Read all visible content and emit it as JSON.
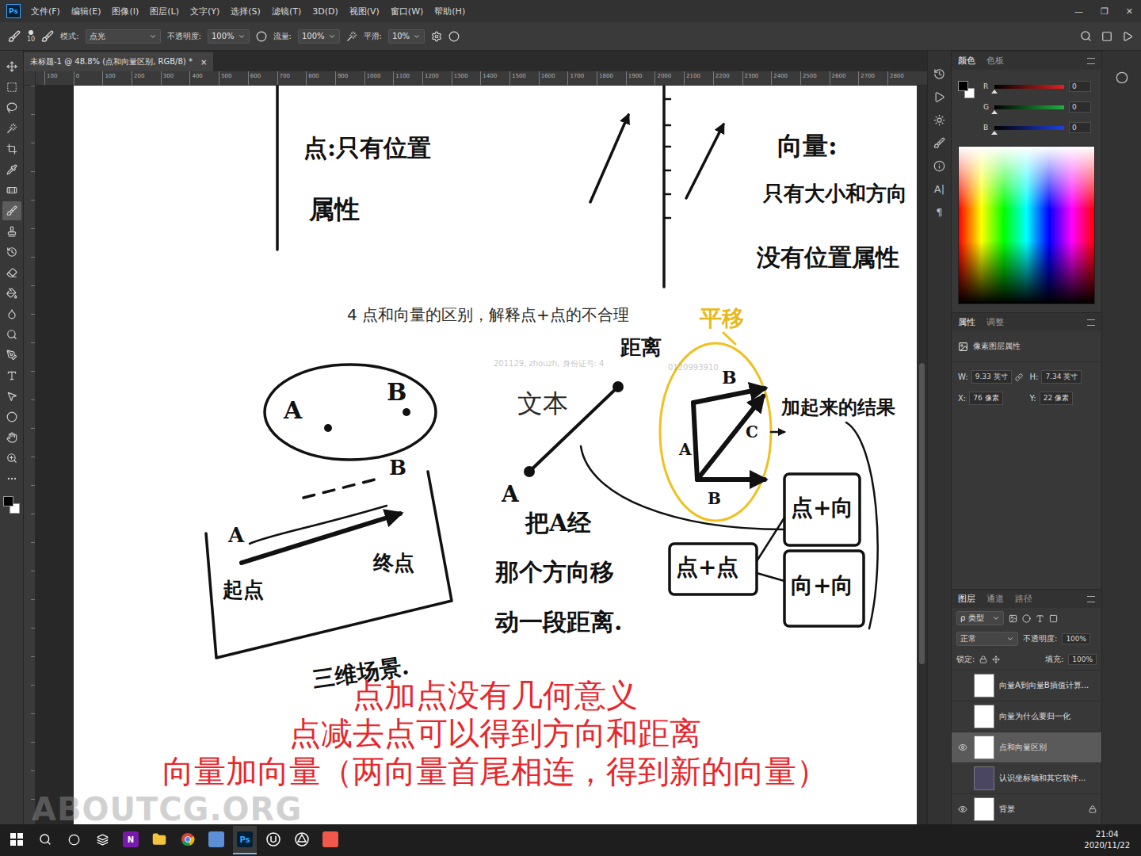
{
  "app": {
    "logo": "Ps",
    "menu": [
      "文件(F)",
      "编辑(E)",
      "图像(I)",
      "图层(L)",
      "文字(Y)",
      "选择(S)",
      "滤镜(T)",
      "3D(D)",
      "视图(V)",
      "窗口(W)",
      "帮助(H)"
    ],
    "window_controls": [
      "—",
      "❐",
      "✕"
    ]
  },
  "options_bar": {
    "brush_size": "10",
    "mode_label": "模式:",
    "mode": "点光",
    "opacity_label": "不透明度:",
    "opacity": "100%",
    "flow_label": "流量:",
    "flow": "100%",
    "smoothing_label": "平滑:",
    "smoothing": "10%"
  },
  "tools": [
    {
      "kind": "move",
      "selected": false
    },
    {
      "kind": "marquee",
      "selected": false
    },
    {
      "kind": "lasso",
      "selected": false
    },
    {
      "kind": "wand",
      "selected": false
    },
    {
      "kind": "crop",
      "selected": false
    },
    {
      "kind": "eyedropper",
      "selected": false
    },
    {
      "kind": "healing",
      "selected": false
    },
    {
      "kind": "brush",
      "selected": true
    },
    {
      "kind": "stamp",
      "selected": false
    },
    {
      "kind": "history",
      "selected": false
    },
    {
      "kind": "eraser",
      "selected": false
    },
    {
      "kind": "bucket",
      "selected": false
    },
    {
      "kind": "blur",
      "selected": false
    },
    {
      "kind": "dodge",
      "selected": false
    },
    {
      "kind": "pen",
      "selected": false
    },
    {
      "kind": "type",
      "selected": false
    },
    {
      "kind": "select",
      "selected": false
    },
    {
      "kind": "shape",
      "selected": false
    },
    {
      "kind": "hand",
      "selected": false
    },
    {
      "kind": "zoom",
      "selected": false
    },
    {
      "kind": "more",
      "selected": false
    }
  ],
  "document": {
    "tab": "未标题-1 @ 48.8% (点和向量区别, RGB/8) *",
    "close": "×",
    "ruler": [
      "100",
      "0",
      "100",
      "200",
      "300",
      "400",
      "500",
      "600",
      "700",
      "800",
      "900",
      "1000",
      "1100",
      "1200",
      "1300",
      "1400",
      "1500",
      "1600",
      "1700",
      "1800",
      "1900",
      "2000",
      "2100",
      "2200",
      "2300",
      "2400",
      "2500",
      "2600",
      "2700",
      "2800"
    ],
    "notes": [
      {
        "text": "点:只有位置",
        "kind": "hand"
      },
      {
        "text": "属性",
        "kind": "hand"
      },
      {
        "text": "向量:",
        "kind": "hand"
      },
      {
        "text": "只有大小和方向",
        "kind": "hand"
      },
      {
        "text": "没有位置属性",
        "kind": "hand"
      },
      {
        "text": "4 点和向量的区别，解释点+点的不合理",
        "kind": "typed"
      },
      {
        "text": "201129, zhouzh, 身份证号: 4",
        "kind": "faint"
      },
      {
        "text": "0120993910",
        "kind": "faint"
      },
      {
        "text": "A",
        "kind": "hand"
      },
      {
        "text": "B",
        "kind": "hand"
      },
      {
        "text": "A",
        "kind": "hand"
      },
      {
        "text": "B",
        "kind": "hand"
      },
      {
        "text": "起点",
        "kind": "hand"
      },
      {
        "text": "终点",
        "kind": "hand"
      },
      {
        "text": "三维场景.",
        "kind": "hand"
      },
      {
        "text": "距离",
        "kind": "hand"
      },
      {
        "text": "文本",
        "kind": "typed"
      },
      {
        "text": "A",
        "kind": "hand"
      },
      {
        "text": "把A经",
        "kind": "hand"
      },
      {
        "text": "那个方向移",
        "kind": "hand"
      },
      {
        "text": "动一段距离.",
        "kind": "hand"
      },
      {
        "text": "平移",
        "kind": "yellow"
      },
      {
        "text": "A",
        "kind": "hand"
      },
      {
        "text": "B",
        "kind": "hand"
      },
      {
        "text": "C",
        "kind": "hand"
      },
      {
        "text": "B",
        "kind": "hand"
      },
      {
        "text": "加起来的结果",
        "kind": "hand"
      },
      {
        "text": "点+向",
        "kind": "hand"
      },
      {
        "text": "点+点",
        "kind": "hand"
      },
      {
        "text": "向+向",
        "kind": "hand"
      }
    ],
    "captions": [
      "点加点没有几何意义",
      "点减去点可以得到方向和距离",
      "向量加向量（两向量首尾相连，得到新的向量）"
    ]
  },
  "side_strip": {
    "glyphs": [
      "A|",
      "¶"
    ]
  },
  "color_panel": {
    "tabs": [
      {
        "label": "颜色",
        "selected": true
      },
      {
        "label": "色板",
        "selected": false
      }
    ],
    "channels": [
      {
        "name": "R",
        "value": "0",
        "level": 0,
        "color": "#e02020"
      },
      {
        "name": "G",
        "value": "0",
        "level": 0,
        "color": "#20b040"
      },
      {
        "name": "B",
        "value": "0",
        "level": 0,
        "color": "#2040e0"
      }
    ]
  },
  "properties_panel": {
    "tabs": [
      {
        "label": "属性",
        "selected": true
      },
      {
        "label": "调整",
        "selected": false
      }
    ],
    "heading": "像素图层属性",
    "fields": [
      {
        "label": "W:",
        "value": "9.33 英寸"
      },
      {
        "label": "H:",
        "value": "7.34 英寸"
      },
      {
        "label": "X:",
        "value": "76 像素"
      },
      {
        "label": "Y:",
        "value": "22 像素"
      }
    ]
  },
  "layers_panel": {
    "tabs": [
      {
        "label": "图层",
        "selected": true
      },
      {
        "label": "通道",
        "selected": false
      },
      {
        "label": "路径",
        "selected": false
      }
    ],
    "filter": "ρ 类型",
    "blend": "正常",
    "opacity_label": "不透明度:",
    "opacity": "100%",
    "lock_label": "锁定:",
    "fill_label": "填充:",
    "fill": "100%",
    "layers": [
      {
        "name": "向量A到向量B插值计算...",
        "visible": false,
        "selected": false,
        "locked": false
      },
      {
        "name": "向量为什么要归一化",
        "visible": false,
        "selected": false,
        "locked": false
      },
      {
        "name": "点和向量区别",
        "visible": true,
        "selected": true,
        "locked": false
      },
      {
        "name": "认识坐标轴和其它软件...",
        "visible": false,
        "selected": false,
        "locked": false
      },
      {
        "name": "背景",
        "visible": true,
        "selected": false,
        "locked": true
      }
    ]
  },
  "watermark": "ABOUTCG.ORG",
  "taskbar": {
    "apps": [
      {
        "kind": "windows",
        "selected": false
      },
      {
        "kind": "search",
        "selected": false
      },
      {
        "kind": "cortana",
        "selected": false
      },
      {
        "kind": "taskview",
        "selected": false
      },
      {
        "kind": "onenote",
        "label": "N",
        "selected": false
      },
      {
        "kind": "explorer",
        "selected": false
      },
      {
        "kind": "chrome",
        "selected": false
      },
      {
        "kind": "notes",
        "selected": false
      },
      {
        "kind": "photoshop",
        "label": "Ps",
        "selected": true
      },
      {
        "kind": "unreal",
        "selected": false
      },
      {
        "kind": "unity",
        "selected": false
      },
      {
        "kind": "recorder",
        "selected": false
      }
    ],
    "time": "21:04",
    "date": "2020/11/22"
  }
}
